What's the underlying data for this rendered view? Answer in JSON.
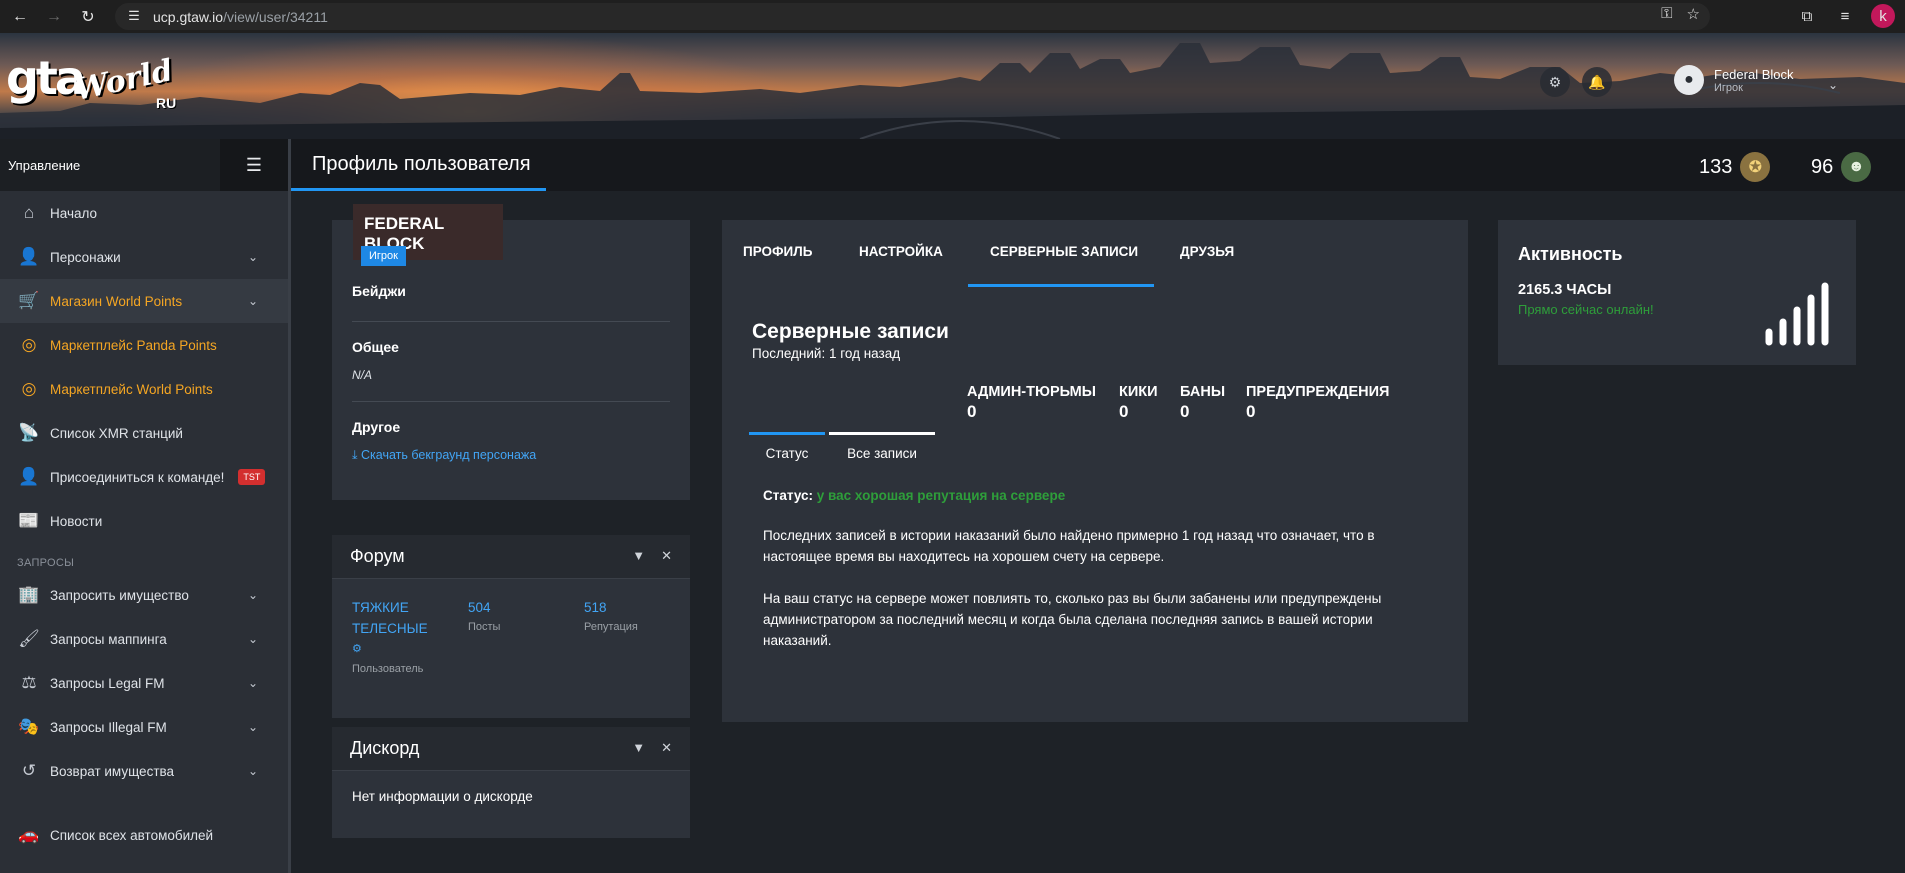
{
  "browser": {
    "url_host": "ucp.gtaw.io",
    "url_path": "/view/user/34211"
  },
  "logo": {
    "gta": "gta",
    "world": "World",
    "ru": "RU"
  },
  "header_user": {
    "name": "Federal Block",
    "role": "Игрок"
  },
  "sidebar": {
    "title": "Управление",
    "items": [
      {
        "label": "Начало",
        "icon": "home-icon",
        "chevron": false,
        "color": "normal"
      },
      {
        "label": "Персонажи",
        "icon": "person-icon",
        "chevron": true,
        "color": "normal"
      },
      {
        "label": "Магазин World Points",
        "icon": "cart-icon",
        "chevron": true,
        "color": "orange"
      },
      {
        "label": "Маркетплейс Panda Points",
        "icon": "coins-icon",
        "chevron": false,
        "color": "orange"
      },
      {
        "label": "Маркетплейс World Points",
        "icon": "coins-icon",
        "chevron": false,
        "color": "orange"
      },
      {
        "label": "Список XMR станций",
        "icon": "antenna-icon",
        "chevron": false,
        "color": "normal"
      },
      {
        "label": "Присоединиться к команде!",
        "icon": "user-tie-icon",
        "chevron": false,
        "color": "normal",
        "badge": "TST"
      },
      {
        "label": "Новости",
        "icon": "newspaper-icon",
        "chevron": false,
        "color": "normal"
      }
    ],
    "section_label": "ЗАПРОСЫ",
    "request_items": [
      {
        "label": "Запросить имущество",
        "icon": "building-icon",
        "chevron": true
      },
      {
        "label": "Запросы маппинга",
        "icon": "brush-icon",
        "chevron": true
      },
      {
        "label": "Запросы Legal FM",
        "icon": "scales-icon",
        "chevron": true
      },
      {
        "label": "Запросы Illegal FM",
        "icon": "mask-icon",
        "chevron": true
      },
      {
        "label": "Возврат имущества",
        "icon": "undo-icon",
        "chevron": true
      }
    ],
    "bottom_item": {
      "label": "Список всех автомобилей",
      "icon": "car-icon"
    }
  },
  "topbar": {
    "title": "Профиль пользователя",
    "counter1": "133",
    "counter2": "96"
  },
  "profile": {
    "name": "FEDERAL BLOCK",
    "role_badge": "Игрок",
    "badges_heading": "Бейджи",
    "general_heading": "Общее",
    "general_value": "N/A",
    "other_heading": "Другое",
    "download_link": "Скачать бекграунд персонажа"
  },
  "forum": {
    "title": "Форум",
    "username": "ТЯЖКИЕ ТЕЛЕСНЫЕ",
    "user_label": "Пользователь",
    "posts_value": "504",
    "posts_label": "Посты",
    "rep_value": "518",
    "rep_label": "Репутация"
  },
  "discord": {
    "title": "Дискорд",
    "body": "Нет информации о дискорде"
  },
  "records": {
    "tabs": [
      "ПРОФИЛЬ",
      "НАСТРОЙКА",
      "СЕРВЕРНЫЕ ЗАПИСИ",
      "ДРУЗЬЯ"
    ],
    "active_tab": 2,
    "title": "Серверные записи",
    "last": "Последний: 1 год назад",
    "stats": [
      {
        "label": "АДМИН-ТЮРЬМЫ",
        "value": "0"
      },
      {
        "label": "КИКИ",
        "value": "0"
      },
      {
        "label": "БАНЫ",
        "value": "0"
      },
      {
        "label": "ПРЕДУПРЕЖДЕНИЯ",
        "value": "0"
      }
    ],
    "subtabs": [
      "Статус",
      "Все записи"
    ],
    "status_label": "Статус:",
    "status_value": "у вас хорошая репутация на сервере",
    "para1": "Последних записей в истории наказаний было найдено примерно 1 год назад что означает, что в настоящее время вы находитесь на хорошем счету на сервере.",
    "para2": "На ваш статус на сервере может повлиять то, сколько раз вы были забанены или предупреждены администратором за последний месяц и когда была сделана последняя запись в вашей истории наказаний."
  },
  "activity": {
    "title": "Активность",
    "hours": "2165.3 ЧАСЫ",
    "online": "Прямо сейчас онлайн!"
  },
  "colors": {
    "accent": "#2196f3",
    "orange": "#f5a623",
    "online_green": "#2e9e3a",
    "card_bg": "#2d323a"
  }
}
